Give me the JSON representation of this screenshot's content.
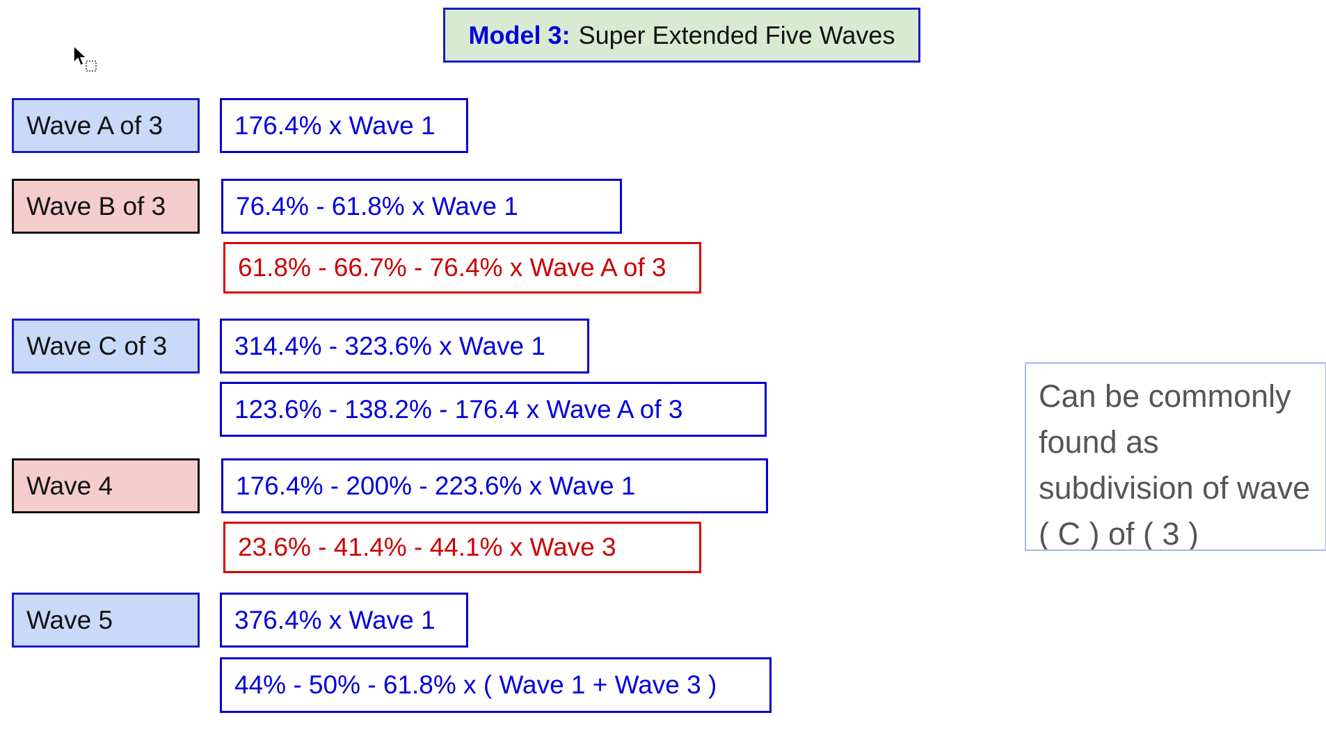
{
  "title": {
    "model": "Model 3:",
    "name": "Super Extended Five Waves"
  },
  "waves": [
    {
      "label": "Wave A of 3",
      "color": "blue",
      "ratios": [
        {
          "text": "176.4% x Wave 1",
          "color": "blue"
        }
      ]
    },
    {
      "label": "Wave B of 3",
      "color": "pink",
      "ratios": [
        {
          "text": "76.4% - 61.8% x Wave 1",
          "color": "blue"
        },
        {
          "text": "61.8% - 66.7% - 76.4% x Wave A of 3",
          "color": "red"
        }
      ]
    },
    {
      "label": "Wave C of 3",
      "color": "blue",
      "ratios": [
        {
          "text": "314.4% - 323.6% x Wave 1",
          "color": "blue"
        },
        {
          "text": "123.6% - 138.2% - 176.4  x Wave A of 3",
          "color": "blue"
        }
      ]
    },
    {
      "label": "Wave 4",
      "color": "pink",
      "ratios": [
        {
          "text": "176.4% - 200% - 223.6% x Wave 1",
          "color": "blue"
        },
        {
          "text": "23.6% - 41.4% - 44.1% x Wave 3",
          "color": "red"
        }
      ]
    },
    {
      "label": "Wave 5",
      "color": "blue",
      "ratios": [
        {
          "text": "376.4% x Wave 1",
          "color": "blue"
        },
        {
          "text": "44% - 50% - 61.8% x ( Wave 1 + Wave 3 )",
          "color": "blue"
        }
      ]
    }
  ],
  "note": "Can be commonly found as subdivision of wave ( C ) of ( 3 )",
  "colors": {
    "label_blue": "#c9daf8",
    "label_pink": "#f4cccc",
    "title_green": "#d9ead3",
    "text_blue": "#0000dd",
    "text_red": "#cc0000"
  }
}
